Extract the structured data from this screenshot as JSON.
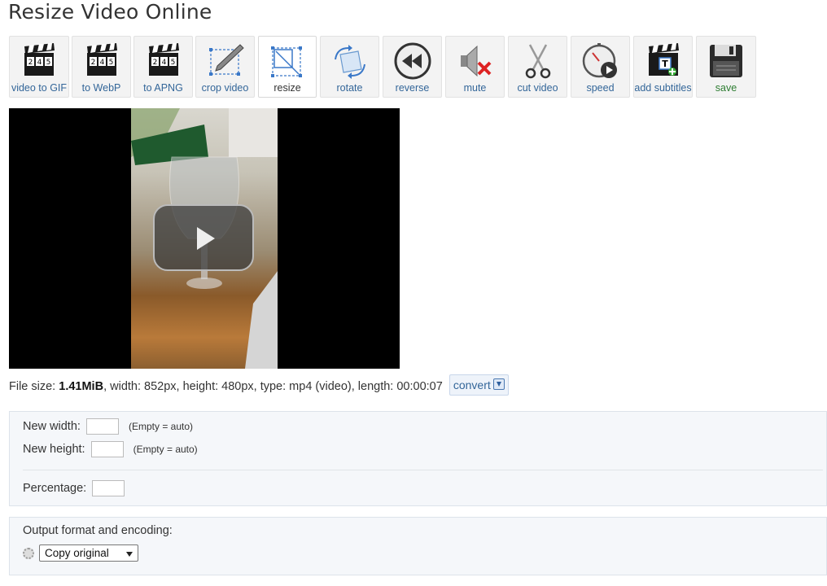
{
  "page": {
    "title": "Resize Video Online"
  },
  "toolbar": {
    "tools": [
      {
        "label": "video to GIF",
        "icon": "clapperboard-icon"
      },
      {
        "label": "to WebP",
        "icon": "clapperboard-icon"
      },
      {
        "label": "to APNG",
        "icon": "clapperboard-icon"
      },
      {
        "label": "crop video",
        "icon": "crop-icon"
      },
      {
        "label": "resize",
        "icon": "resize-icon",
        "active": true
      },
      {
        "label": "rotate",
        "icon": "rotate-icon"
      },
      {
        "label": "reverse",
        "icon": "reverse-icon"
      },
      {
        "label": "mute",
        "icon": "mute-icon"
      },
      {
        "label": "cut video",
        "icon": "scissors-icon"
      },
      {
        "label": "speed",
        "icon": "speed-icon"
      },
      {
        "label": "add subtitles",
        "icon": "subtitles-icon"
      },
      {
        "label": "save",
        "icon": "save-icon"
      }
    ]
  },
  "info": {
    "prefix": "File size: ",
    "file_size": "1.41MiB",
    "rest": ", width: 852px, height: 480px, type: mp4 (video), length: 00:00:07",
    "convert_label": "convert"
  },
  "resize_form": {
    "width_label": "New width:",
    "width_value": "",
    "height_label": "New height:",
    "height_value": "",
    "auto_hint": "(Empty = auto)",
    "percentage_label": "Percentage:",
    "percentage_value": ""
  },
  "output": {
    "label": "Output format and encoding:",
    "selected": "Copy original"
  },
  "colors": {
    "link": "#336699",
    "save": "#2e7d32"
  }
}
